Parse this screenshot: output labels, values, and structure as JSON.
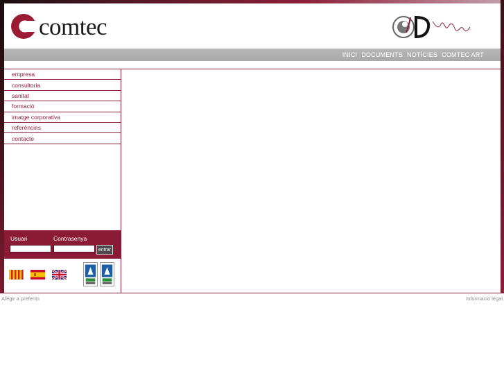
{
  "brand": {
    "name": "comtec",
    "accent": "#8e1d3a"
  },
  "nav": {
    "items": [
      "INICI",
      "DOCUMENTS",
      "NOTÍCIES",
      "COMTEC ART"
    ]
  },
  "sidebar": {
    "items": [
      {
        "label": "empresa"
      },
      {
        "label": "consultoria"
      },
      {
        "label": "sanitat"
      },
      {
        "label": "formació"
      },
      {
        "label": "imatge corporativa"
      },
      {
        "label": "referències"
      },
      {
        "label": "contacte"
      }
    ]
  },
  "login": {
    "user_label": "Usuari",
    "password_label": "Contrasenya",
    "user_value": "",
    "password_value": "",
    "submit_label": "entrar"
  },
  "languages": [
    "catalan-flag-icon",
    "spanish-flag-icon",
    "uk-flag-icon"
  ],
  "certifications": [
    "dnv-cert-icon",
    "dnv-cert-icon"
  ],
  "footer": {
    "left": "Afegir a preferits",
    "right": "Informació legal"
  }
}
